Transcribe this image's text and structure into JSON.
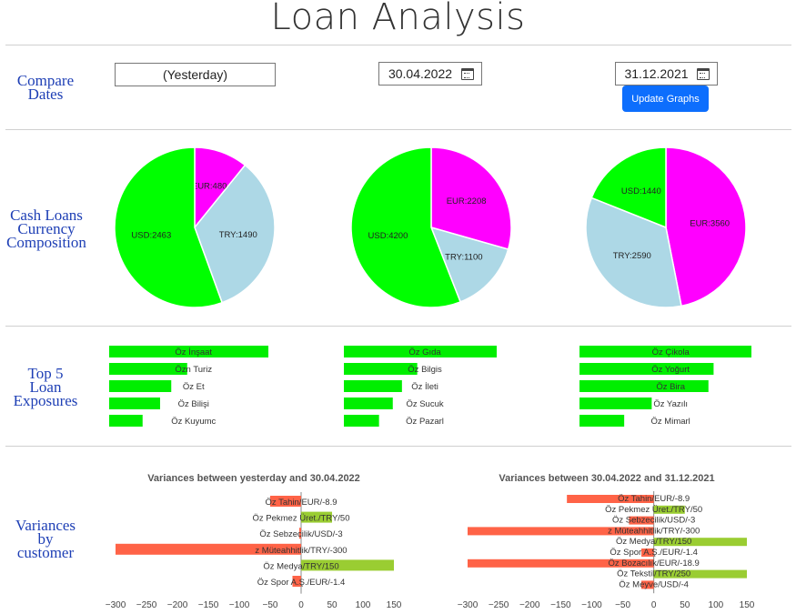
{
  "title": "Loan Analysis",
  "labels": {
    "compare_dates": [
      "Compare",
      "Dates"
    ],
    "currency": [
      "Cash Loans",
      "Currency",
      "Composition"
    ],
    "top5": [
      "Top 5",
      "Loan",
      "Exposures"
    ],
    "variances": [
      "Variances",
      "by",
      "customer"
    ]
  },
  "dates": {
    "d1": "(Yesterday)",
    "d2": "30.04.2022",
    "d3": "31.12.2021"
  },
  "update_button": "Update Graphs",
  "colors": {
    "USD": "#00ff00",
    "TRY": "#add8e6",
    "EUR": "#ff00ff",
    "bar": "#00ee00",
    "neg": "#ff6347",
    "pos": "#9acd32"
  },
  "pies": [
    [
      {
        "label": "EUR:480",
        "value": 480,
        "cur": "EUR"
      },
      {
        "label": "TRY:1490",
        "value": 1490,
        "cur": "TRY"
      },
      {
        "label": "USD:2463",
        "value": 2463,
        "cur": "USD"
      }
    ],
    [
      {
        "label": "EUR:2208",
        "value": 2208,
        "cur": "EUR"
      },
      {
        "label": "TRY:1100",
        "value": 1100,
        "cur": "TRY"
      },
      {
        "label": "USD:4200",
        "value": 4200,
        "cur": "USD"
      }
    ],
    [
      {
        "label": "EUR:3560",
        "value": 3560,
        "cur": "EUR"
      },
      {
        "label": "TRY:2590",
        "value": 2590,
        "cur": "TRY"
      },
      {
        "label": "USD:1440",
        "value": 1440,
        "cur": "USD"
      }
    ]
  ],
  "top5": [
    [
      {
        "name": "Öz İnşaat",
        "value": 100
      },
      {
        "name": "Özn Turiz",
        "value": 49
      },
      {
        "name": "Öz Et",
        "value": 39
      },
      {
        "name": "Öz Bilişi",
        "value": 32
      },
      {
        "name": "Öz Kuyumc",
        "value": 21
      }
    ],
    [
      {
        "name": "Öz Gıda",
        "value": 100
      },
      {
        "name": "Öz Bilgis",
        "value": 48
      },
      {
        "name": "Öz İleti",
        "value": 38
      },
      {
        "name": "Öz Sucuk",
        "value": 32
      },
      {
        "name": "Öz Pazarl",
        "value": 23
      }
    ],
    [
      {
        "name": "Öz Çikola",
        "value": 100
      },
      {
        "name": "Öz Yoğurt",
        "value": 78
      },
      {
        "name": "Öz Bira",
        "value": 75
      },
      {
        "name": "Öz Yazılı",
        "value": 42
      },
      {
        "name": "Öz Mimarl",
        "value": 26
      }
    ]
  ],
  "chart_data": [
    {
      "type": "bar",
      "orientation": "horizontal",
      "title": "Variances between yesterday and 30.04.2022",
      "xlim": [
        -300,
        150
      ],
      "xticks": [
        -300,
        -250,
        -200,
        -150,
        -100,
        -50,
        0,
        50,
        100,
        150
      ],
      "categories": [
        "Öz Tahin/EUR/-8.9",
        "Öz Pekmez Üret./TRY/50",
        "Öz Sebzecilik/USD/-3",
        "z Müteahhitlik/TRY/-300",
        "Öz Medya/TRY/150",
        "Öz Spor A.Ş./EUR/-1.4"
      ],
      "values": [
        -50,
        50,
        -3,
        -300,
        150,
        -14
      ]
    },
    {
      "type": "bar",
      "orientation": "horizontal",
      "title": "Variances between 30.04.2022 and 31.12.2021",
      "xlim": [
        -300,
        150
      ],
      "xticks": [
        -300,
        -250,
        -200,
        -150,
        -100,
        -50,
        0,
        50,
        100,
        150
      ],
      "categories": [
        "Öz Tahin/EUR/-8.9",
        "Öz Pekmez Üret./TRY/50",
        "Öz Sebzecilik/USD/-3",
        "z Müteahhitlik/TRY/-300",
        "Öz Medya/TRY/150",
        "Öz Spor A.Ş./EUR/-1.4",
        "Öz Bozacılık/EUR/-18.9",
        "Öz Tekstil/TRY/250",
        "Öz Meyve/USD/-4"
      ],
      "values": [
        -140,
        50,
        -40,
        -300,
        150,
        -20,
        -300,
        150,
        -20
      ]
    }
  ]
}
